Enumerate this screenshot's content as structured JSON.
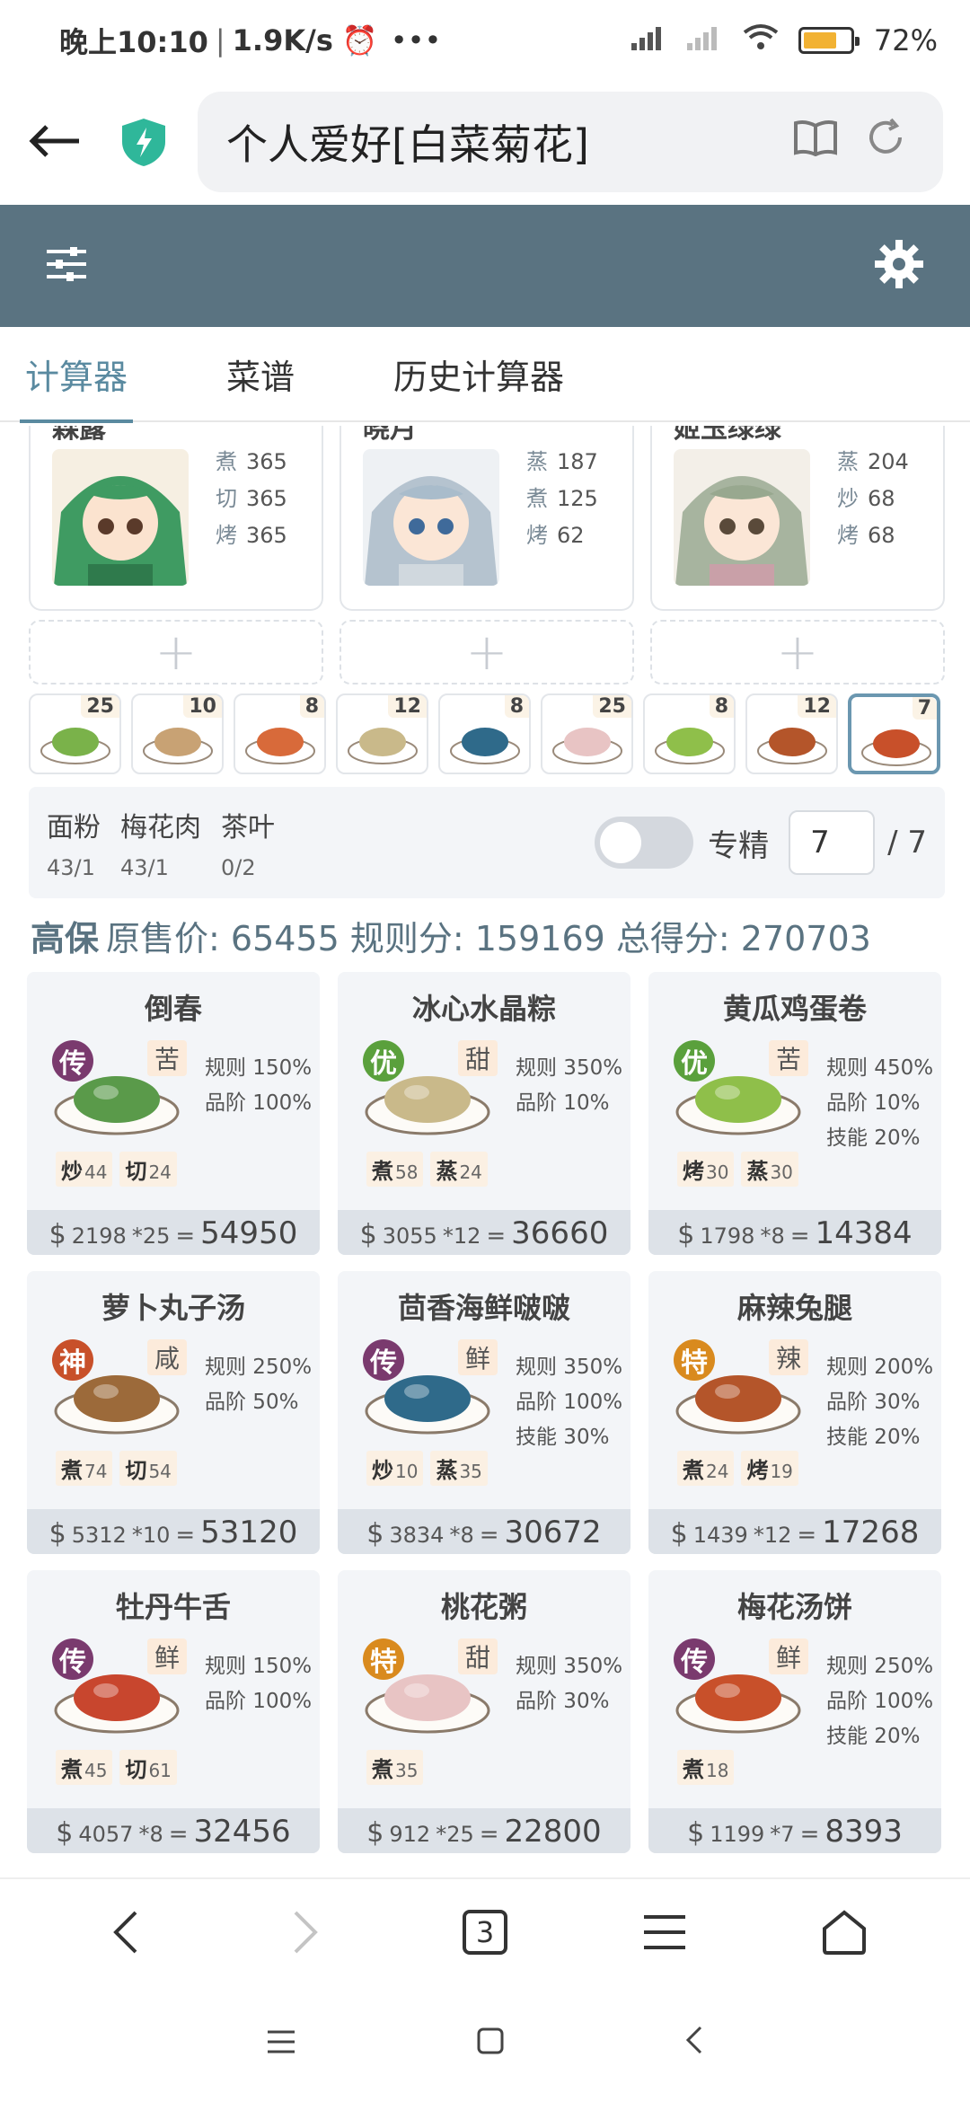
{
  "statusbar": {
    "time": "晚上10:10",
    "speed": "1.9K/s",
    "battery": "72%",
    "battery_level": 0.72
  },
  "browser": {
    "url_title": "个人爱好[白菜菊花]",
    "tab_count": "3"
  },
  "tabs": [
    {
      "label": "计算器"
    },
    {
      "label": "菜谱"
    },
    {
      "label": "历史计算器"
    }
  ],
  "chefs": [
    {
      "name": "森露",
      "skills": [
        {
          "k": "煮",
          "v": "365"
        },
        {
          "k": "切",
          "v": "365"
        },
        {
          "k": "烤",
          "v": "365"
        }
      ],
      "color": "#4aa36a"
    },
    {
      "name": "晓月",
      "skills": [
        {
          "k": "蒸",
          "v": "187"
        },
        {
          "k": "煮",
          "v": "125"
        },
        {
          "k": "烤",
          "v": "62"
        }
      ],
      "color": "#9fb2c4"
    },
    {
      "name": "姬玉绿绿",
      "skills": [
        {
          "k": "蒸",
          "v": "204"
        },
        {
          "k": "炒",
          "v": "68"
        },
        {
          "k": "烤",
          "v": "68"
        }
      ],
      "color": "#a9b8a2"
    }
  ],
  "thumbs": [
    "25",
    "10",
    "8",
    "12",
    "8",
    "25",
    "8",
    "12",
    "7"
  ],
  "materials": [
    {
      "name": "面粉",
      "value": "43/1"
    },
    {
      "name": "梅花肉",
      "value": "43/1"
    },
    {
      "name": "茶叶",
      "value": "0/2"
    }
  ],
  "zhuanjing": {
    "label": "专精",
    "value": "7",
    "max": "/ 7"
  },
  "summary": {
    "badge": "高保",
    "text": "原售价: 65455 规则分: 159169 总得分: 270703"
  },
  "dishes": [
    {
      "name": "倒春",
      "rarity": "传",
      "rarity_color": "#7a3a6e",
      "taste": "苦",
      "stats": [
        "规则 150%",
        "品阶 100%"
      ],
      "ings": [
        {
          "k": "炒",
          "v": "44"
        },
        {
          "k": "切",
          "v": "24"
        }
      ],
      "price": "2198",
      "mult": "*25",
      "total": "54950",
      "plate": "#5a9a4a"
    },
    {
      "name": "冰心水晶粽",
      "rarity": "优",
      "rarity_color": "#5aa03c",
      "taste": "甜",
      "stats": [
        "规则 350%",
        "品阶 10%"
      ],
      "ings": [
        {
          "k": "煮",
          "v": "58"
        },
        {
          "k": "蒸",
          "v": "24"
        }
      ],
      "price": "3055",
      "mult": "*12",
      "total": "36660",
      "plate": "#c9b98a"
    },
    {
      "name": "黄瓜鸡蛋卷",
      "rarity": "优",
      "rarity_color": "#5aa03c",
      "taste": "苦",
      "stats": [
        "规则 450%",
        "品阶 10%",
        "技能 20%"
      ],
      "ings": [
        {
          "k": "烤",
          "v": "30"
        },
        {
          "k": "蒸",
          "v": "30"
        }
      ],
      "price": "1798",
      "mult": "*8",
      "total": "14384",
      "plate": "#8fbf4a"
    },
    {
      "name": "萝卜丸子汤",
      "rarity": "神",
      "rarity_color": "#c8502a",
      "taste": "咸",
      "stats": [
        "规则 250%",
        "品阶 50%"
      ],
      "ings": [
        {
          "k": "煮",
          "v": "74"
        },
        {
          "k": "切",
          "v": "54"
        }
      ],
      "price": "5312",
      "mult": "*10",
      "total": "53120",
      "plate": "#9c6a3a"
    },
    {
      "name": "茴香海鲜啵啵",
      "rarity": "传",
      "rarity_color": "#7a3a6e",
      "taste": "鲜",
      "stats": [
        "规则 350%",
        "品阶 100%",
        "技能 30%"
      ],
      "ings": [
        {
          "k": "炒",
          "v": "10"
        },
        {
          "k": "蒸",
          "v": "35"
        }
      ],
      "price": "3834",
      "mult": "*8",
      "total": "30672",
      "plate": "#2f6a8a"
    },
    {
      "name": "麻辣兔腿",
      "rarity": "特",
      "rarity_color": "#d98a1e",
      "taste": "辣",
      "stats": [
        "规则 200%",
        "品阶 30%",
        "技能 20%"
      ],
      "ings": [
        {
          "k": "煮",
          "v": "24"
        },
        {
          "k": "烤",
          "v": "19"
        }
      ],
      "price": "1439",
      "mult": "*12",
      "total": "17268",
      "plate": "#b4552a"
    },
    {
      "name": "牡丹牛舌",
      "rarity": "传",
      "rarity_color": "#7a3a6e",
      "taste": "鲜",
      "stats": [
        "规则 150%",
        "品阶 100%"
      ],
      "ings": [
        {
          "k": "煮",
          "v": "45"
        },
        {
          "k": "切",
          "v": "61"
        }
      ],
      "price": "4057",
      "mult": "*8",
      "total": "32456",
      "plate": "#c8462e"
    },
    {
      "name": "桃花粥",
      "rarity": "特",
      "rarity_color": "#d98a1e",
      "taste": "甜",
      "stats": [
        "规则 350%",
        "品阶 30%"
      ],
      "ings": [
        {
          "k": "煮",
          "v": "35"
        }
      ],
      "price": "912",
      "mult": "*25",
      "total": "22800",
      "plate": "#e8c4c4"
    },
    {
      "name": "梅花汤饼",
      "rarity": "传",
      "rarity_color": "#7a3a6e",
      "taste": "鲜",
      "stats": [
        "规则 250%",
        "品阶 100%",
        "技能 20%"
      ],
      "ings": [
        {
          "k": "煮",
          "v": "18"
        }
      ],
      "price": "1199",
      "mult": "*7",
      "total": "8393",
      "plate": "#c8502a"
    }
  ]
}
